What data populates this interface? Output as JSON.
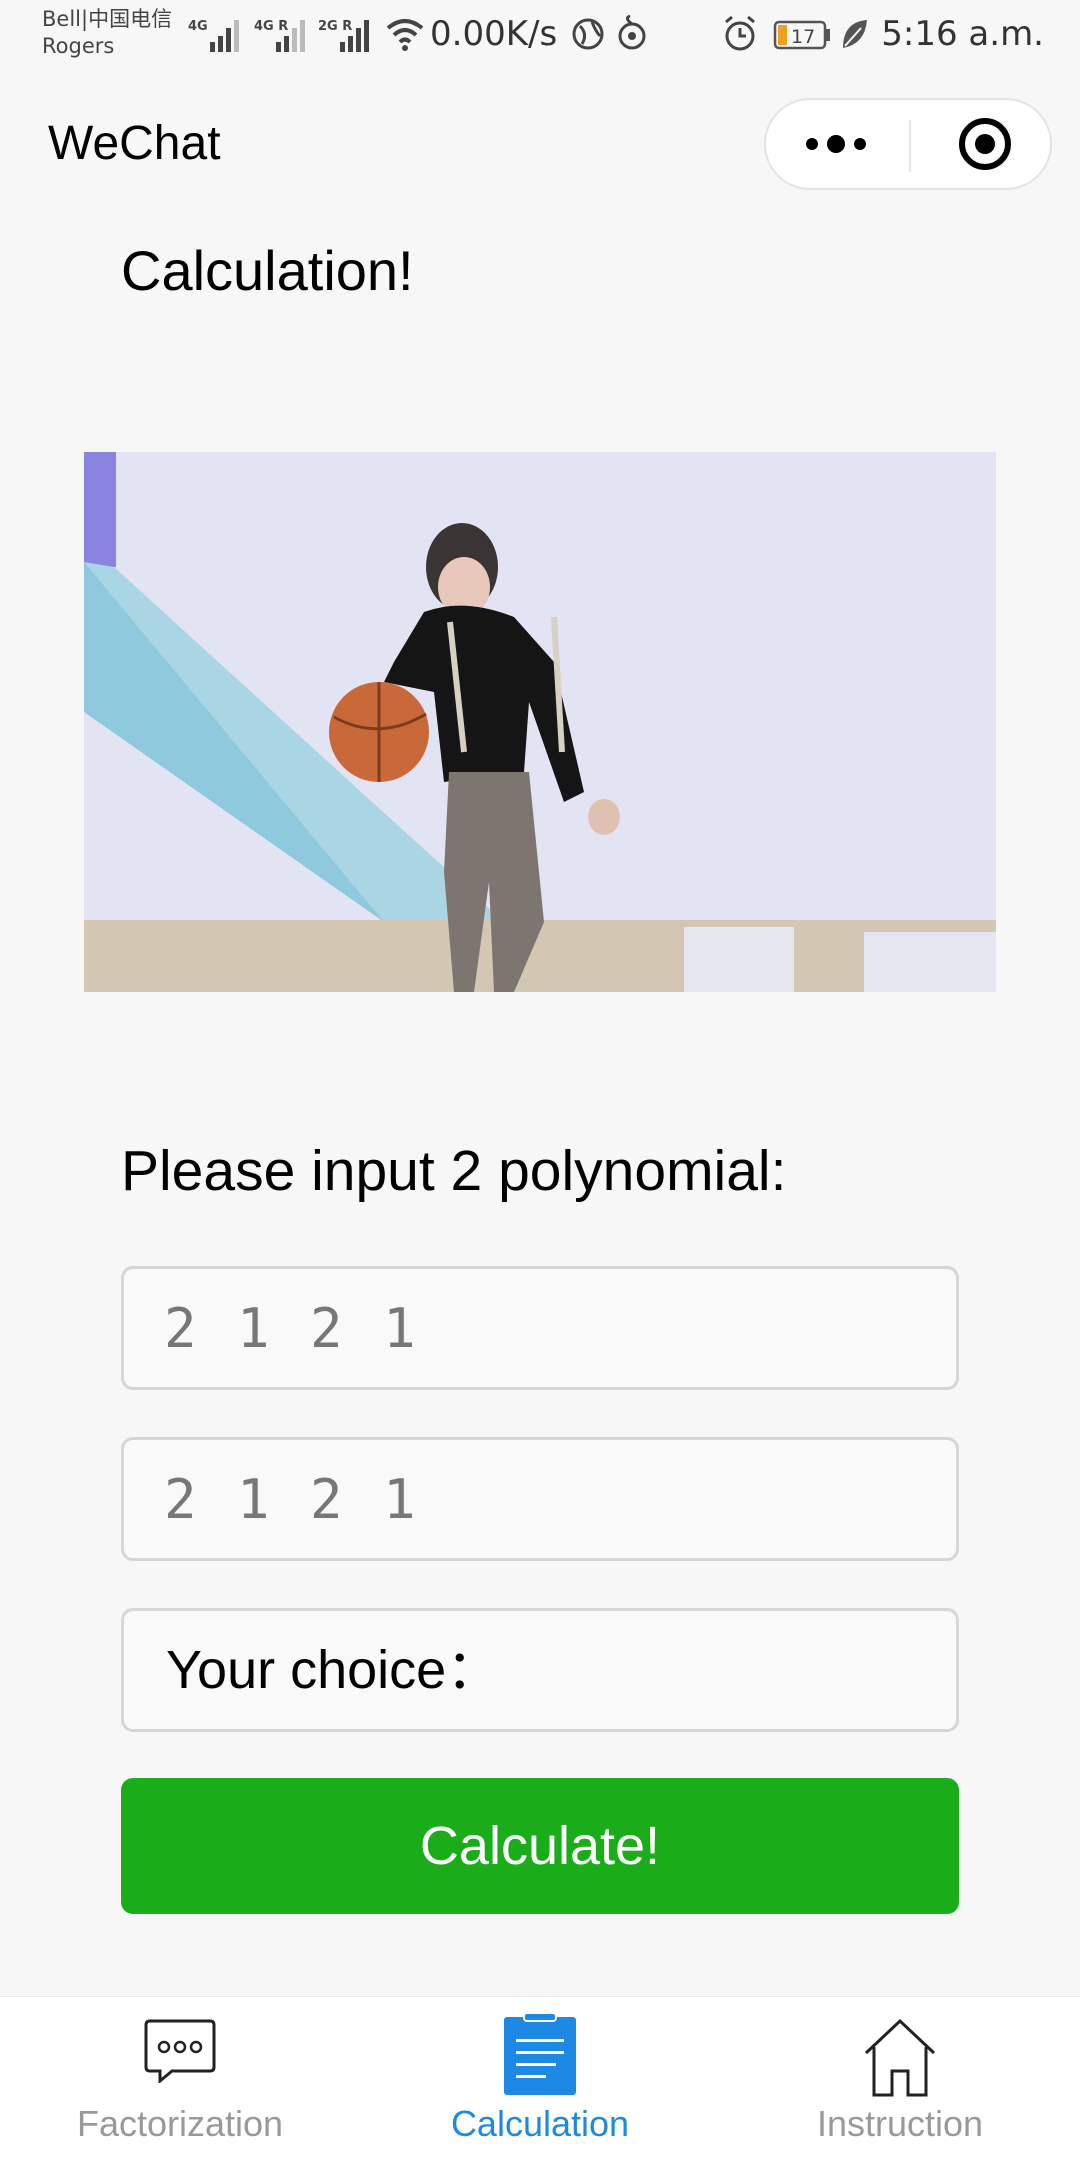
{
  "status_bar": {
    "carrier_line1": "Bell|中国电信",
    "carrier_line2": "Rogers",
    "net_speed": "0.00K/s",
    "battery": "17",
    "time": "5:16 a.m."
  },
  "nav": {
    "title": "WeChat"
  },
  "main": {
    "heading": "Calculation!",
    "prompt": "Please input 2 polynomial:",
    "input1_value": "2 1 2 1",
    "input2_value": "2 1 2 1",
    "choice_label": "Your choice：",
    "calculate_label": "Calculate!"
  },
  "tabs": [
    {
      "label": "Factorization",
      "icon": "chat-bubble-icon",
      "active": false
    },
    {
      "label": "Calculation",
      "icon": "document-icon",
      "active": true
    },
    {
      "label": "Instruction",
      "icon": "home-icon",
      "active": false
    }
  ],
  "colors": {
    "primary_button": "#1aad19",
    "active_tab": "#1e88e5",
    "inactive_tab": "#999999",
    "background": "#f7f7f7"
  }
}
